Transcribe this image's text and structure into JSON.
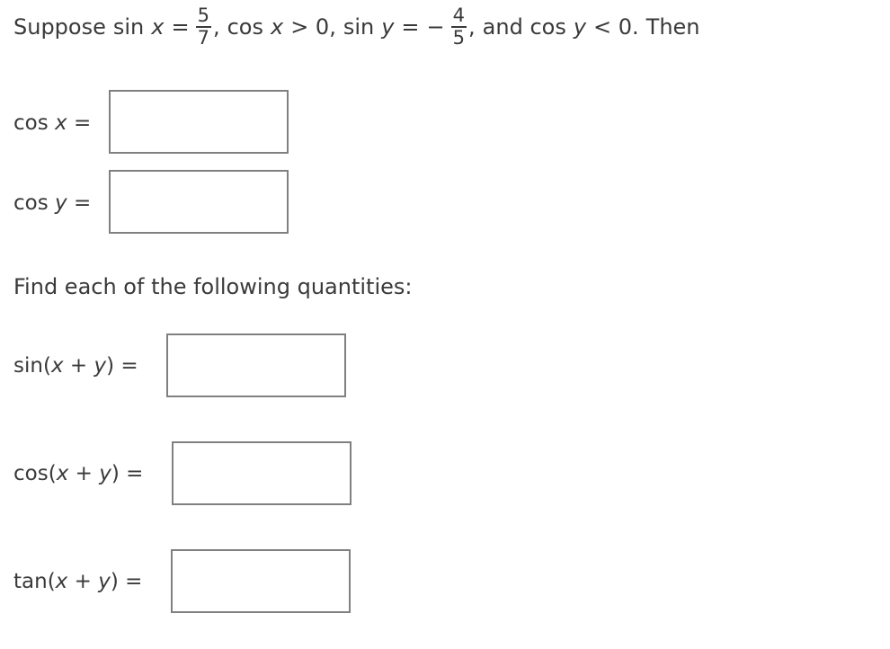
{
  "problem": {
    "intro": "Suppose",
    "given": {
      "sin_x_lhs": "sin",
      "var_x": "x",
      "eq": "=",
      "sin_x_num": "5",
      "sin_x_den": "7",
      "comma1": ",",
      "cos_x_cond_fn": "cos",
      "cos_x_cond_var": "x",
      "cos_x_cond_rel": "> 0,",
      "sin_y_lhs": "sin",
      "var_y": "y",
      "eq2": "=",
      "minus": "−",
      "sin_y_num": "4",
      "sin_y_den": "5",
      "comma2": ",",
      "and_text": "and cos",
      "cos_y_cond_var": "y",
      "cos_y_cond_rel": "< 0.",
      "then_text": "Then"
    }
  },
  "first_answers": [
    {
      "fn": "cos",
      "var": "x",
      "eq": "=",
      "value": ""
    },
    {
      "fn": "cos",
      "var": "y",
      "eq": "=",
      "value": ""
    }
  ],
  "instruction": "Find each of the following quantities:",
  "quantities": [
    {
      "fn": "sin(",
      "x": "x",
      "plus": "+",
      "y": "y",
      "close": ")",
      "eq": "=",
      "value": ""
    },
    {
      "fn": "cos(",
      "x": "x",
      "plus": "+",
      "y": "y",
      "close": ")",
      "eq": "=",
      "value": ""
    },
    {
      "fn": "tan(",
      "x": "x",
      "plus": "+",
      "y": "y",
      "close": ")",
      "eq": "=",
      "value": ""
    }
  ]
}
